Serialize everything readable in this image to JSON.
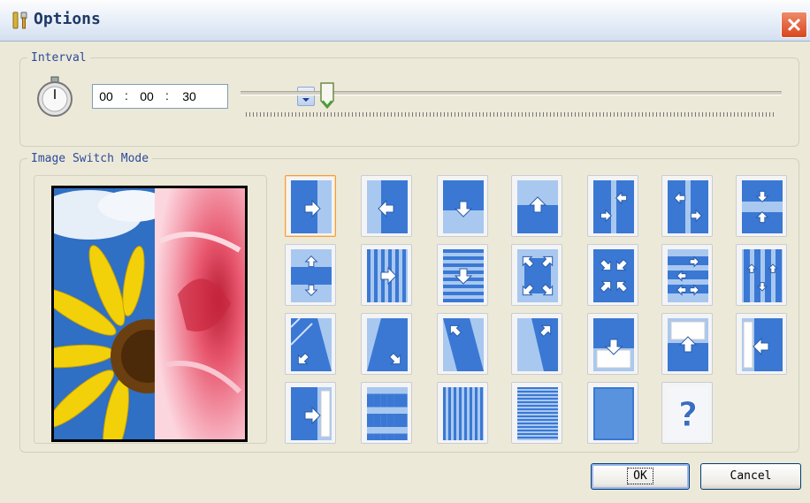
{
  "window": {
    "title": "Options",
    "app_icon": "tools-icon",
    "close_icon": "close-icon"
  },
  "interval": {
    "legend": "Interval",
    "icon": "stopwatch-icon",
    "hours": "00",
    "minutes": "00",
    "seconds": "30",
    "separator": ":",
    "slider_value_fraction": 0.16
  },
  "switch_mode": {
    "legend": "Image Switch Mode",
    "selected_index": 0,
    "modes": [
      "push-right",
      "push-left",
      "push-down",
      "push-up",
      "split-vertical-cross",
      "split-vertical-cross-alt",
      "split-horizontal-in",
      "split-horizontal-out",
      "stripes-vertical-right",
      "stripes-horizontal-down",
      "expand-corners",
      "collapse-corners",
      "cross-arrows",
      "bars-vertical-arrows",
      "diagonal-down-left",
      "diagonal-down-right",
      "diagonal-up-left",
      "diagonal-up-right",
      "slide-down-over",
      "slide-up-over",
      "slide-left-over",
      "slide-right-over",
      "checkerboard",
      "blinds-vertical",
      "blinds-horizontal",
      "fade",
      "random"
    ],
    "random_label": "?"
  },
  "buttons": {
    "ok": "OK",
    "cancel": "Cancel"
  },
  "colors": {
    "accent_blue": "#3a78d4",
    "close_red": "#d9471e",
    "selected_border": "#f0a040"
  }
}
